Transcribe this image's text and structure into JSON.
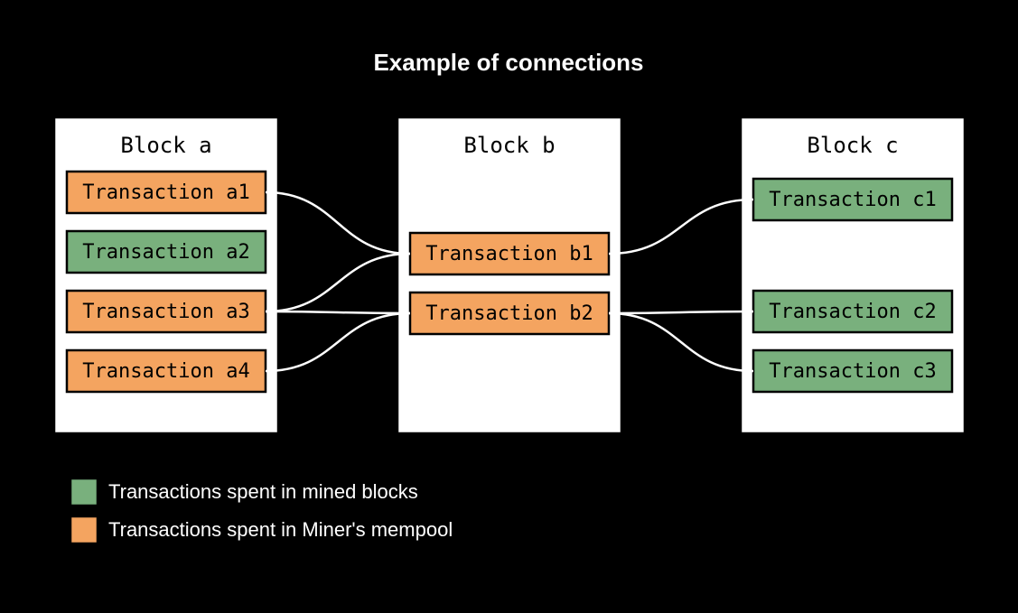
{
  "title": "Example of connections",
  "legend": {
    "green": "Transactions spent in mined blocks",
    "orange": "Transactions spent in Miner's mempool"
  },
  "blocks": {
    "a": {
      "label": "Block a",
      "txs": {
        "a1": {
          "label": "Transaction a1",
          "status": "orange"
        },
        "a2": {
          "label": "Transaction a2",
          "status": "green"
        },
        "a3": {
          "label": "Transaction a3",
          "status": "orange"
        },
        "a4": {
          "label": "Transaction a4",
          "status": "orange"
        }
      }
    },
    "b": {
      "label": "Block b",
      "txs": {
        "b1": {
          "label": "Transaction b1",
          "status": "orange"
        },
        "b2": {
          "label": "Transaction b2",
          "status": "orange"
        }
      }
    },
    "c": {
      "label": "Block c",
      "txs": {
        "c1": {
          "label": "Transaction c1",
          "status": "green"
        },
        "c2": {
          "label": "Transaction c2",
          "status": "green"
        },
        "c3": {
          "label": "Transaction c3",
          "status": "green"
        }
      }
    }
  },
  "edges": [
    {
      "from": "a1",
      "to": "b1"
    },
    {
      "from": "a3",
      "to": "b1"
    },
    {
      "from": "a3",
      "to": "b2"
    },
    {
      "from": "a4",
      "to": "b2"
    },
    {
      "from": "b1",
      "to": "c1"
    },
    {
      "from": "b2",
      "to": "c2"
    },
    {
      "from": "b2",
      "to": "c3"
    }
  ]
}
